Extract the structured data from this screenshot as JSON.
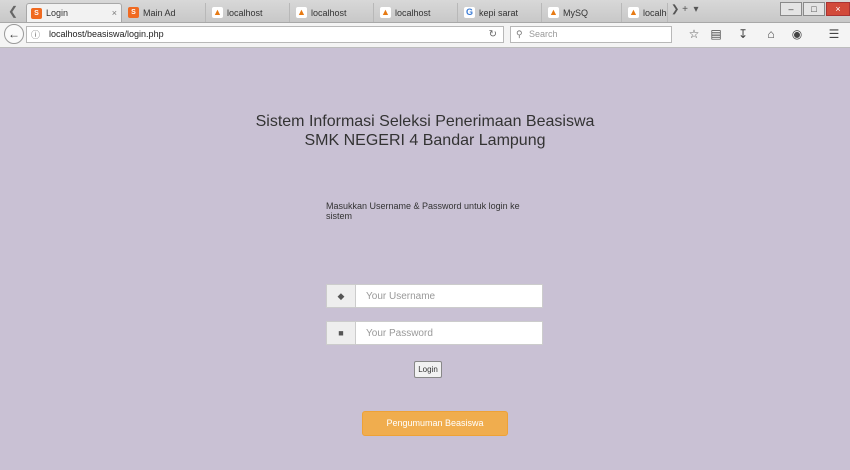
{
  "tabs": [
    {
      "label": "Login",
      "favicon": "xampp-icon",
      "active": true
    },
    {
      "label": "Main Ad",
      "favicon": "xampp-icon"
    },
    {
      "label": "localhost",
      "favicon": "phpmyadmin-icon"
    },
    {
      "label": "localhost",
      "favicon": "phpmyadmin-icon"
    },
    {
      "label": "localhost",
      "favicon": "phpmyadmin-icon"
    },
    {
      "label": "kepi sarat",
      "favicon": "google-icon"
    },
    {
      "label": "MySQ",
      "favicon": "phpmyadmin-icon"
    },
    {
      "label": "localhost",
      "favicon": "phpmyadmin-icon"
    }
  ],
  "nav": {
    "url": "localhost/beasiswa/login.php",
    "search_placeholder": "Search"
  },
  "page": {
    "title_line1": "Sistem Informasi Seleksi Penerimaan Beasiswa",
    "title_line2": "SMK NEGERI 4 Bandar Lampung",
    "instruction": "Masukkan Username & Password untuk login ke sistem",
    "username_placeholder": "Your Username",
    "password_placeholder": "Your Password",
    "login_label": "Login",
    "announce_label": "Pengumuman Beasiswa"
  },
  "colors": {
    "background": "#c9c1d4",
    "announce_button": "#f0ad4e"
  }
}
